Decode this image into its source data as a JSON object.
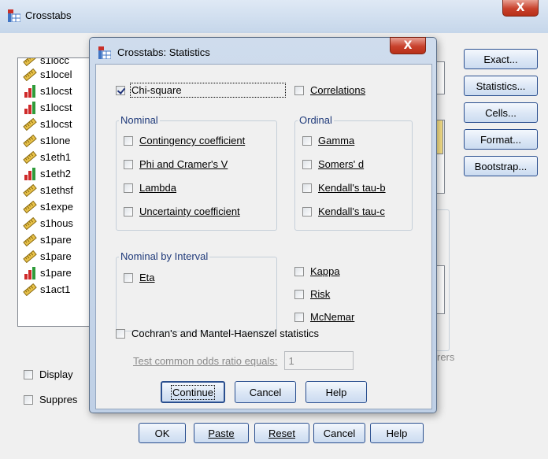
{
  "outer": {
    "title": "Crosstabs",
    "close_glyph": "X",
    "variables": [
      {
        "label": "s1locc",
        "type": "scale",
        "partial": true
      },
      {
        "label": "s1locel",
        "type": "scale"
      },
      {
        "label": "s1locst",
        "type": "nominal"
      },
      {
        "label": "s1locst",
        "type": "nominal"
      },
      {
        "label": "s1locst",
        "type": "scale"
      },
      {
        "label": "s1lone",
        "type": "scale"
      },
      {
        "label": "s1eth1",
        "type": "scale"
      },
      {
        "label": "s1eth2",
        "type": "nominal"
      },
      {
        "label": "s1ethsf",
        "type": "scale"
      },
      {
        "label": "s1expe",
        "type": "scale"
      },
      {
        "label": "s1hous",
        "type": "scale"
      },
      {
        "label": "s1pare",
        "type": "scale"
      },
      {
        "label": "s1pare",
        "type": "scale"
      },
      {
        "label": "s1pare",
        "type": "nominal"
      },
      {
        "label": "s1act1",
        "type": "scale"
      }
    ],
    "side_buttons": [
      "Exact...",
      "Statistics...",
      "Cells...",
      "Format...",
      "Bootstrap..."
    ],
    "display_label": "Display",
    "suppress_label": "Suppres",
    "layers_fragment": "rers",
    "bottom_buttons": [
      "OK",
      "Paste",
      "Reset",
      "Cancel",
      "Help"
    ]
  },
  "dialog": {
    "title": "Crosstabs: Statistics",
    "close_glyph": "X",
    "chi_square": {
      "label": "Chi-square",
      "checked": true
    },
    "correlations": {
      "label": "Correlations",
      "checked": false
    },
    "nominal": {
      "legend": "Nominal",
      "items": [
        {
          "label": "Contingency coefficient",
          "checked": false
        },
        {
          "label": "Phi and Cramer's V",
          "checked": false
        },
        {
          "label": "Lambda",
          "checked": false
        },
        {
          "label": "Uncertainty coefficient",
          "checked": false
        }
      ]
    },
    "ordinal": {
      "legend": "Ordinal",
      "items": [
        {
          "label": "Gamma",
          "checked": false
        },
        {
          "label": "Somers' d",
          "checked": false
        },
        {
          "label": "Kendall's tau-b",
          "checked": false
        },
        {
          "label": "Kendall's tau-c",
          "checked": false
        }
      ]
    },
    "nominal_by_interval": {
      "legend": "Nominal by Interval",
      "items": [
        {
          "label": "Eta",
          "checked": false
        }
      ]
    },
    "extras": [
      {
        "label": "Kappa",
        "checked": false
      },
      {
        "label": "Risk",
        "checked": false
      },
      {
        "label": "McNemar",
        "checked": false
      }
    ],
    "cochran": {
      "label": "Cochran's and Mantel-Haenszel statistics",
      "checked": false
    },
    "odds_ratio": {
      "label": "Test common odds ratio equals:",
      "value": "1"
    },
    "buttons": {
      "continue": "Continue",
      "cancel": "Cancel",
      "help": "Help"
    }
  },
  "colors": {
    "accent": "#2a4f8f",
    "legend_text": "#1f3a7a",
    "close_red": "#c8412c"
  }
}
